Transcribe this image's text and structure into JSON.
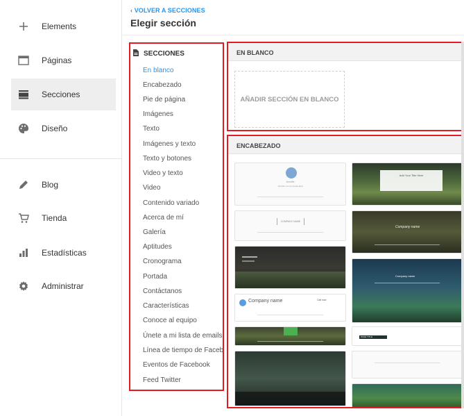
{
  "nav": {
    "items": [
      {
        "label": "Elements",
        "icon": "plus-icon"
      },
      {
        "label": "Páginas",
        "icon": "browser-window-icon"
      },
      {
        "label": "Secciones",
        "icon": "sections-icon"
      },
      {
        "label": "Diseño",
        "icon": "palette-icon"
      },
      {
        "label": "Blog",
        "icon": "pencil-icon"
      },
      {
        "label": "Tienda",
        "icon": "cart-icon"
      },
      {
        "label": "Estadísticas",
        "icon": "bar-chart-icon"
      },
      {
        "label": "Administrar",
        "icon": "gear-icon"
      }
    ],
    "active": "Secciones"
  },
  "header": {
    "back_label": "VOLVER A SECCIONES",
    "title": "Elegir sección"
  },
  "sections": {
    "heading": "SECCIONES",
    "items": [
      "En blanco",
      "Encabezado",
      "Pie de página",
      "Imágenes",
      "Texto",
      "Imágenes y texto",
      "Texto y botones",
      "Video y texto",
      "Video",
      "Contenido variado",
      "Acerca de mí",
      "Galería",
      "Aptitudes",
      "Cronograma",
      "Portada",
      "Contáctanos",
      "Características",
      "Conoce al equipo",
      "Únete a mi lista de emails",
      "Línea de tiempo de Facebook",
      "Eventos de Facebook",
      "Feed Twitter"
    ],
    "active": "En blanco"
  },
  "blank": {
    "heading": "EN BLANCO",
    "button_label": "AÑADIR SECCIÓN EN BLANCO"
  },
  "encabezado": {
    "heading": "ENCABEZADO",
    "thumb_texts": {
      "t1_name": "Jennifer",
      "t1_sub": "Jennifer con mi propia idea",
      "t2_logo": "COMPANY NAME",
      "t4_company": "Company name",
      "t4_phone": "Call now",
      "r1_title": "Add Your Title Here",
      "r2_company": "Company name",
      "r3_company": "Company name",
      "r4_title": "PAGE TITLE"
    }
  },
  "colors": {
    "accent": "#2196f3",
    "highlight_border": "#e11b22"
  }
}
